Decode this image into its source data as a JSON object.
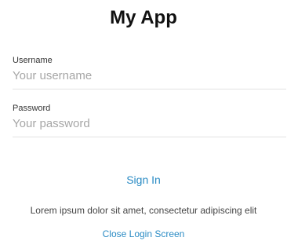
{
  "app": {
    "title": "My App"
  },
  "form": {
    "username": {
      "label": "Username",
      "placeholder": "Your username",
      "value": ""
    },
    "password": {
      "label": "Password",
      "placeholder": "Your password",
      "value": ""
    }
  },
  "actions": {
    "sign_in_label": "Sign In",
    "close_label": "Close Login Screen"
  },
  "body_text": "Lorem ipsum dolor sit amet, consectetur adipiscing elit",
  "colors": {
    "accent": "#2a8bc4",
    "divider": "#e2e2e2",
    "placeholder": "#a6a6a6"
  }
}
